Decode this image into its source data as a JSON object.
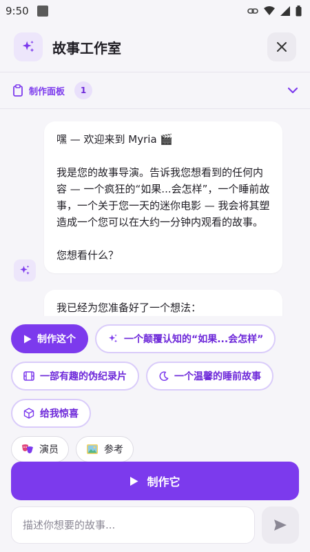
{
  "status": {
    "time": "9:50"
  },
  "header": {
    "title": "故事工作室"
  },
  "panel": {
    "label": "制作面板",
    "count": "1"
  },
  "messages": [
    {
      "paragraphs": [
        "嘿 — 欢迎来到 Myria 🎬",
        "我是您的故事导演。告诉我您想看到的任何内容 — 一个疯狂的“如果...会怎样”，一个睡前故事，一个关于您一天的迷你电影 — 我会将其塑造成一个您可以在大约一分钟内观看的故事。",
        "您想看什么？"
      ]
    },
    {
      "paragraphs": [
        "我已经为您准备好了一个想法："
      ]
    }
  ],
  "chips": {
    "make_this": "制作这个",
    "what_if": "一个颠覆认知的“如果...会怎样”",
    "mockumentary": "一部有趣的伪纪录片",
    "bedtime": "一个温馨的睡前故事",
    "surprise": "给我惊喜",
    "actors": "演员",
    "reference": "参考"
  },
  "make_button": {
    "label": "制作它"
  },
  "composer": {
    "placeholder": "描述你想要的故事..."
  },
  "colors": {
    "accent": "#7c3aed",
    "accent_light": "#ede6fb"
  },
  "icons": {
    "app": "sparkles-icon",
    "close": "close-icon",
    "panel": "clipboard-icon",
    "expand": "chevron-down-icon",
    "play": "play-icon",
    "film": "film-icon",
    "moon": "moon-icon",
    "cube": "cube-icon",
    "masks": "theater-masks-icon",
    "image": "image-icon",
    "send": "send-icon"
  }
}
